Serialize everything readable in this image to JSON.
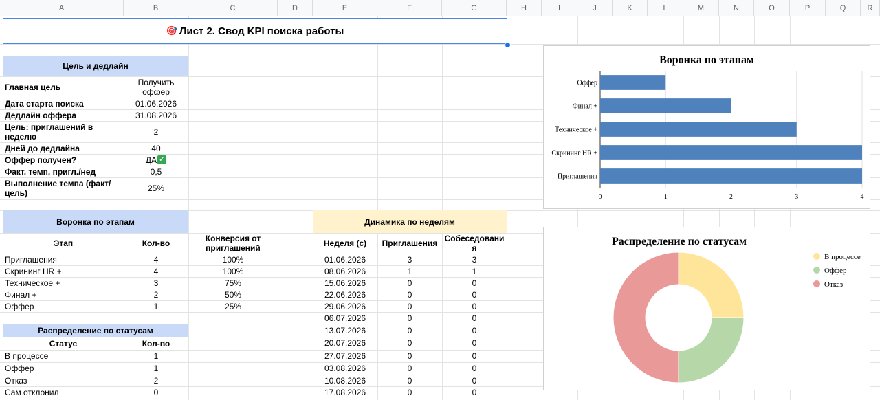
{
  "columns": [
    "A",
    "B",
    "C",
    "D",
    "E",
    "F",
    "G",
    "H",
    "I",
    "J",
    "K",
    "L",
    "M",
    "N",
    "O",
    "P",
    "Q",
    "R"
  ],
  "title": {
    "icon": "🎯",
    "text": "Лист 2. Свод KPI поиска работы"
  },
  "goal": {
    "header": "Цель и дедлайн",
    "rows": [
      {
        "label": "Главная цель",
        "value": "Получить оффер"
      },
      {
        "label": "Дата старта поиска",
        "value": "01.06.2026"
      },
      {
        "label": "Дедлайн оффера",
        "value": "31.08.2026"
      },
      {
        "label": "Цель: приглашений в неделю",
        "value": "2"
      },
      {
        "label": "Дней до дедлайна",
        "value": "40"
      },
      {
        "label": "Оффер получен?",
        "value": "ДА"
      },
      {
        "label": "Факт. темп, пригл./нед",
        "value": "0,5"
      },
      {
        "label": "Выполнение темпа (факт/цель)",
        "value": "25%"
      }
    ],
    "offer_check_icon": "check-mark-icon"
  },
  "funnel": {
    "header": "Воронка по этапам",
    "col_stage": "Этап",
    "col_count": "Кол-во",
    "col_conv": "Конверсия от приглашений",
    "rows": [
      {
        "stage": "Приглашения",
        "count": "4",
        "conv": "100%"
      },
      {
        "stage": "Скрининг HR +",
        "count": "4",
        "conv": "100%"
      },
      {
        "stage": "Техническое +",
        "count": "3",
        "conv": "75%"
      },
      {
        "stage": "Финал +",
        "count": "2",
        "conv": "50%"
      },
      {
        "stage": "Оффер",
        "count": "1",
        "conv": "25%"
      }
    ]
  },
  "statuses": {
    "header": "Распределение по статусам",
    "col_status": "Статус",
    "col_count": "Кол-во",
    "rows": [
      {
        "status": "В процессе",
        "count": "1"
      },
      {
        "status": "Оффер",
        "count": "1"
      },
      {
        "status": "Отказ",
        "count": "2"
      },
      {
        "status": "Сам отклонил",
        "count": "0"
      }
    ]
  },
  "weekly": {
    "header": "Динамика по неделям",
    "col_week": "Неделя (с)",
    "col_inv": "Приглашения",
    "col_int": "Собеседования",
    "rows": [
      {
        "week": "01.06.2026",
        "inv": "3",
        "int": "3"
      },
      {
        "week": "08.06.2026",
        "inv": "1",
        "int": "1"
      },
      {
        "week": "15.06.2026",
        "inv": "0",
        "int": "0"
      },
      {
        "week": "22.06.2026",
        "inv": "0",
        "int": "0"
      },
      {
        "week": "29.06.2026",
        "inv": "0",
        "int": "0"
      },
      {
        "week": "06.07.2026",
        "inv": "0",
        "int": "0"
      },
      {
        "week": "13.07.2026",
        "inv": "0",
        "int": "0"
      },
      {
        "week": "20.07.2026",
        "inv": "0",
        "int": "0"
      },
      {
        "week": "27.07.2026",
        "inv": "0",
        "int": "0"
      },
      {
        "week": "03.08.2026",
        "inv": "0",
        "int": "0"
      },
      {
        "week": "10.08.2026",
        "inv": "0",
        "int": "0"
      },
      {
        "week": "17.08.2026",
        "inv": "0",
        "int": "0"
      }
    ]
  },
  "chart_data": [
    {
      "type": "bar",
      "orientation": "horizontal",
      "title": "Воронка по этапам",
      "categories": [
        "Оффер",
        "Финал +",
        "Техническое +",
        "Скрининг HR +",
        "Приглашения"
      ],
      "values": [
        1,
        2,
        3,
        4,
        4
      ],
      "xlim": [
        0,
        4
      ],
      "xticks": [
        "0",
        "1",
        "2",
        "3",
        "4"
      ],
      "bar_color": "#4f81bd",
      "grid": true
    },
    {
      "type": "pie",
      "variant": "donut",
      "title": "Распределение по статусам",
      "labels": [
        "В процессе",
        "Оффер",
        "Отказ"
      ],
      "values": [
        1,
        1,
        2
      ],
      "colors": [
        "#ffe599",
        "#b6d7a8",
        "#ea9999"
      ],
      "legend": "right"
    }
  ]
}
